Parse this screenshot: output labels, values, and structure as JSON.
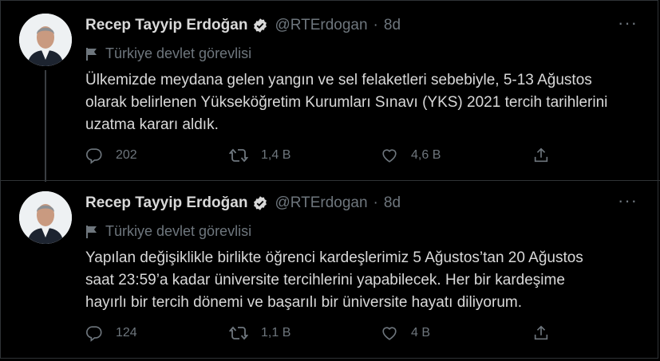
{
  "colors": {
    "background": "#000000",
    "text": "#d9d9d9",
    "muted": "#6e767d",
    "divider": "#2f3336",
    "verified": "#d9d9d9"
  },
  "tweets": [
    {
      "author_name": "Recep Tayyip Erdoğan",
      "handle": "@RTErdogan",
      "separator": "·",
      "time": "8d",
      "label": "Türkiye devlet görevlisi",
      "text_lines": [
        "Ülkemizde meydana gelen yangın ve sel felaketleri sebebiyle, 5-13 Ağustos",
        "olarak belirlenen Yükseköğretim Kurumları Sınavı (YKS) 2021 tercih tarihlerini",
        "uzatma kararı aldık."
      ],
      "reply_count": "202",
      "retweet_count": "1,4 B",
      "like_count": "4,6 B"
    },
    {
      "author_name": "Recep Tayyip Erdoğan",
      "handle": "@RTErdogan",
      "separator": "·",
      "time": "8d",
      "label": "Türkiye devlet görevlisi",
      "text_lines": [
        "Yapılan değişiklikle birlikte öğrenci kardeşlerimiz 5 Ağustos’tan 20 Ağustos",
        "saat 23:59’a kadar üniversite tercihlerini yapabilecek. Her bir kardeşime",
        "hayırlı bir tercih dönemi ve başarılı bir üniversite hayatı diliyorum."
      ],
      "reply_count": "124",
      "retweet_count": "1,1 B",
      "like_count": "4 B"
    }
  ],
  "icons": [
    "more-icon",
    "verified-badge-icon",
    "flag-icon",
    "reply-icon",
    "retweet-icon",
    "like-icon",
    "share-icon"
  ]
}
